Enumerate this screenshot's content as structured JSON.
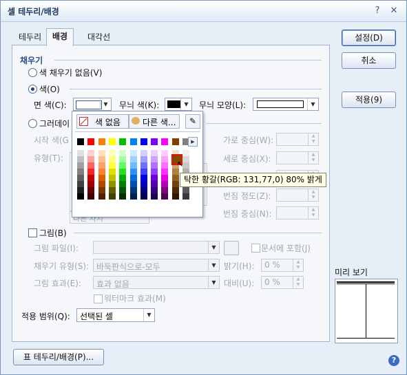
{
  "window": {
    "title": "셀 테두리/배경",
    "help_label": "?",
    "close_label": "✕"
  },
  "tabs": [
    {
      "label": "테두리"
    },
    {
      "label": "배경"
    },
    {
      "label": "대각선"
    }
  ],
  "fill": {
    "section_title": "채우기",
    "no_fill_label": "색 채우기 없음(V)",
    "color_label": "색(O)",
    "face_color_label": "면 색(C):",
    "pattern_color_label": "무늬 색(K):",
    "pattern_shape_label": "무늬 모양(L):",
    "gradient_label": "그러데이",
    "start_color_label": "시작 색(G",
    "type_label": "유형(T):",
    "h_center_label": "가로 중심(W):",
    "v_center_label": "세로 중심(X):",
    "blur_degree_label": "번짐 정도(Z):",
    "blur_center_label": "번짐 중심(N):",
    "gradient_preset": "다른 차지"
  },
  "picture": {
    "label": "그림(B)",
    "file_label": "그림 파일(I):",
    "include_doc_label": "문서에 포함(J)",
    "fill_type_label": "채우기 유형(S):",
    "fill_type_value": "바둑판식으로-모두",
    "brightness_label": "밝기(H):",
    "brightness_value": "0 %",
    "effect_label": "그림 효과(E):",
    "effect_value": "효과 없음",
    "contrast_label": "대비(U):",
    "contrast_value": "0 %",
    "watermark_label": "워터마크 효과(M)"
  },
  "apply_scope": {
    "label": "적용 범위(Q):",
    "value": "선택된 셀"
  },
  "buttons": {
    "ok": "설정(D)",
    "cancel": "취소",
    "apply": "적용(9)",
    "border_bg": "표 테두리/배경(P)..."
  },
  "preview_label": "미리 보기",
  "popup": {
    "no_color_label": "색 없음",
    "other_color_label": "다른 색...",
    "top_row_colors": [
      "#000000",
      "#ff0000",
      "#ff8000",
      "#ffff00",
      "#00c000",
      "#0080ff",
      "#0000ff",
      "#8000ff",
      "#ff00ff",
      "#804000",
      "#808080"
    ],
    "shade_columns": [
      [
        "#e0e0e0",
        "#c0c0c0",
        "#a0a0a0",
        "#808080",
        "#606060",
        "#404040",
        "#202020",
        "#000000"
      ],
      [
        "#ffd0d0",
        "#ffa0a0",
        "#ff6060",
        "#ff2020",
        "#d00000",
        "#a00000",
        "#700000",
        "#400000"
      ],
      [
        "#ffe0c0",
        "#ffc090",
        "#ffa060",
        "#ff8030",
        "#e06000",
        "#b04800",
        "#803400",
        "#502000"
      ],
      [
        "#ffffc0",
        "#ffff80",
        "#ffff40",
        "#e0e000",
        "#c0c000",
        "#909000",
        "#606000",
        "#404000"
      ],
      [
        "#d0ffd0",
        "#a0ffa0",
        "#60ff60",
        "#20e020",
        "#00b000",
        "#008000",
        "#005800",
        "#003000"
      ],
      [
        "#d0e8ff",
        "#a0d0ff",
        "#70b8ff",
        "#3090ff",
        "#0070e0",
        "#0050b0",
        "#003880",
        "#002050"
      ],
      [
        "#d0d0ff",
        "#a0a0ff",
        "#7070ff",
        "#4040ff",
        "#0000e0",
        "#0000b0",
        "#000080",
        "#000050"
      ],
      [
        "#e8d0ff",
        "#d0a0ff",
        "#b070ff",
        "#9040ff",
        "#7000e0",
        "#5000b0",
        "#380080",
        "#200050"
      ],
      [
        "#ffd0ff",
        "#ffa0ff",
        "#ff70ff",
        "#ff30ff",
        "#e000e0",
        "#b000b0",
        "#800080",
        "#500050"
      ],
      [
        "#f0e0d0",
        "#e0c0a0",
        "#d0a070",
        "#b08040",
        "#906020",
        "#704010",
        "#502800",
        "#301800"
      ],
      [
        "#f0f0f0",
        "#d8d8d8",
        "#c8c8c8",
        "#b0b0b0",
        "#989898",
        "#838d00",
        "#5a5a5a",
        "#3a3a3a"
      ]
    ],
    "highlight_color": "#834d00",
    "highlight_border": "#e01010",
    "tooltip": "탁한 황갈(RGB: 131,77,0) 80% 밝게"
  }
}
